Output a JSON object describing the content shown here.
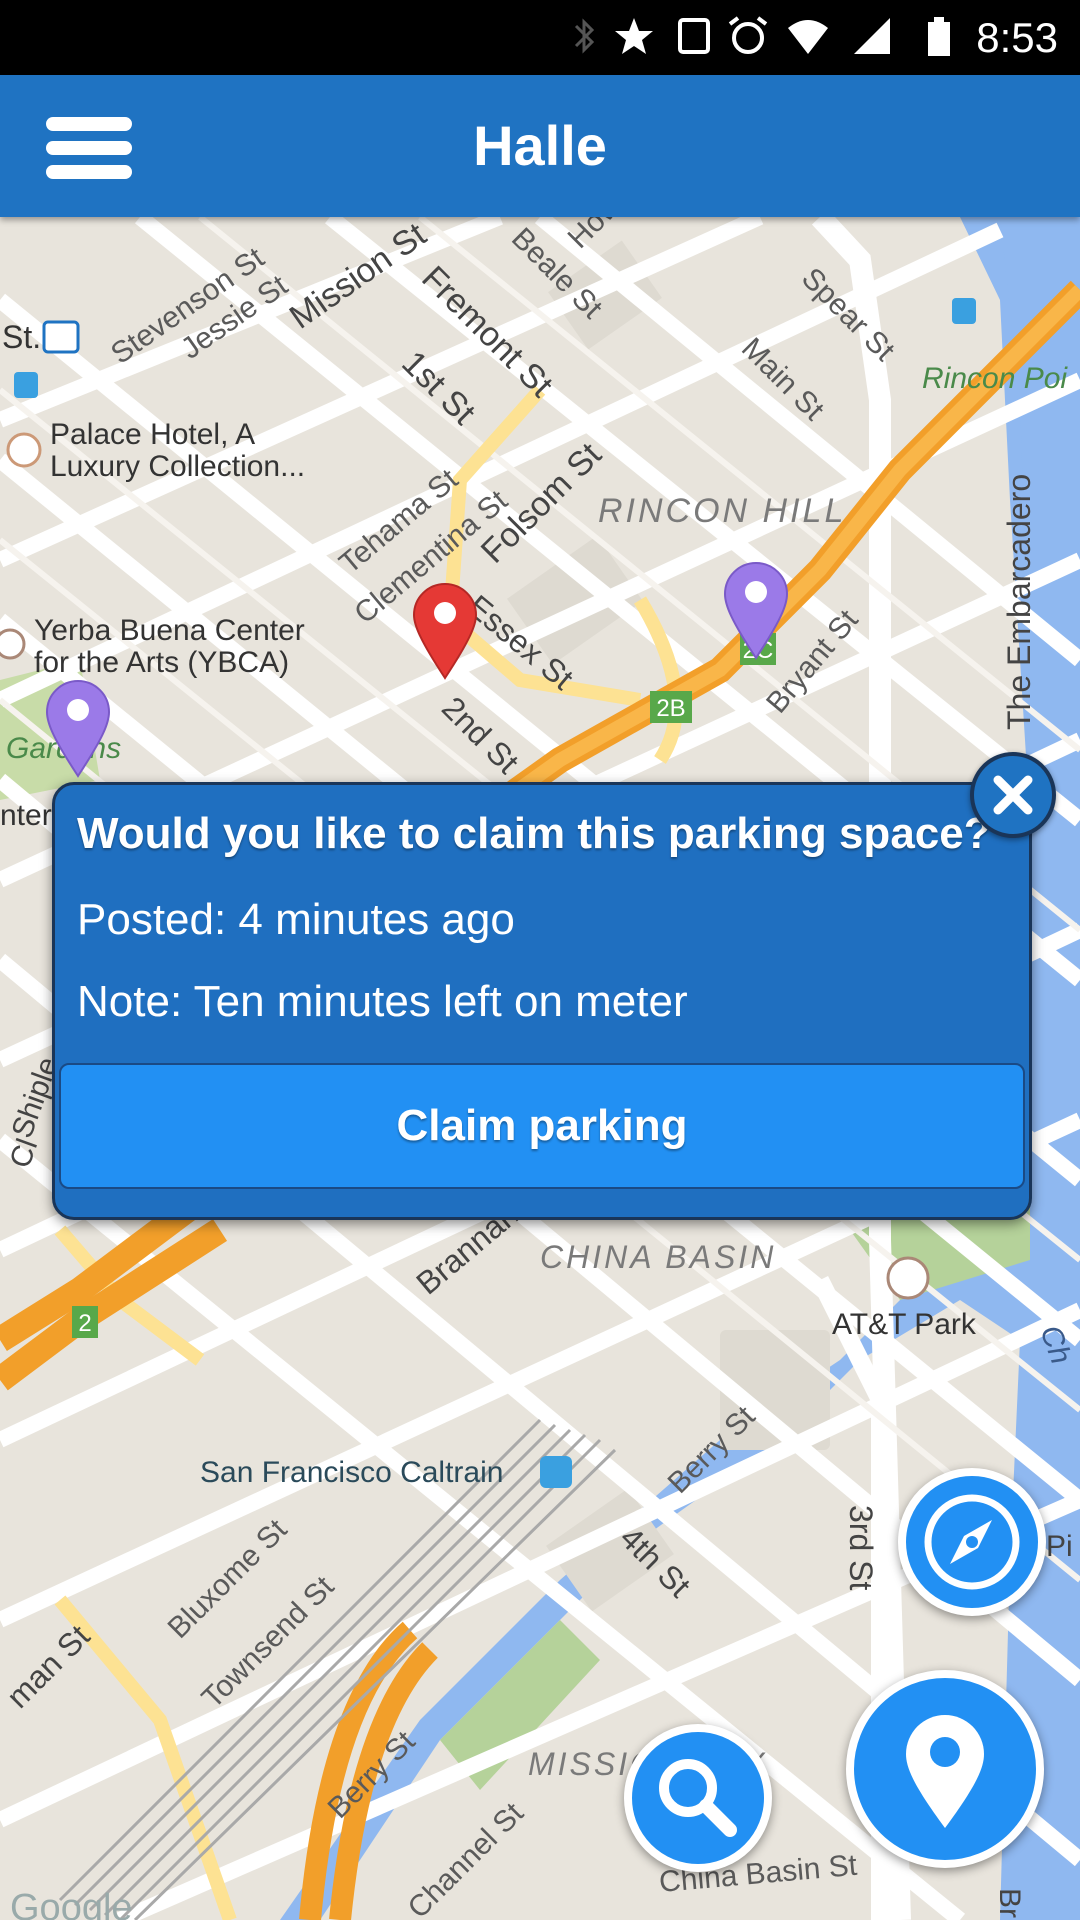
{
  "status_bar": {
    "time": "8:53",
    "icons": [
      "bluetooth-icon",
      "star-icon",
      "vibrate-icon",
      "alarm-icon",
      "wifi-icon",
      "signal-icon",
      "battery-icon"
    ]
  },
  "app_bar": {
    "title": "Halle",
    "menu_icon": "hamburger-menu-icon"
  },
  "map": {
    "labels": {
      "stevenson": "Stevenson St",
      "jessie": "Jessie St",
      "mission": "Mission St",
      "fremont": "Fremont St",
      "beale": "Beale St",
      "howard": "How",
      "spear": "Spear St",
      "main": "Main St",
      "rincon_point": "Rincon Poi",
      "st": "St.",
      "palace1": "Palace Hotel, A",
      "palace2": "Luxury Collection...",
      "first": "1st St",
      "tehama": "Tehama St",
      "clementina": "Clementina St",
      "folsom": "Folsom St",
      "rincon_hill": "RINCON HILL",
      "embarcadero": "The Embarcadero",
      "ybca1": "Yerba Buena Center",
      "ybca2": "for the Arts (YBCA)",
      "essex": "Essex St",
      "bryant": "Bryant St",
      "shield_2c": "2C",
      "shield_2b": "2B",
      "gardens": "Gardens",
      "second": "2nd St",
      "center": "nter",
      "brannan": "Brannan St",
      "china_basin": "CHINA BASIN",
      "att_park": "AT&T Park",
      "shield_2": "2",
      "caltrain": "San Francisco Caltrain",
      "berry1": "Berry St",
      "fourth": "4th St",
      "third": "3rd St",
      "bluxome": "Bluxome St",
      "townsend": "Townsend St",
      "king": "man St",
      "berry2": "Berry St",
      "mission_bay": "MISSION BAY",
      "channel": "Channel St",
      "china_basin_st": "China Basin St",
      "google": "Google",
      "pier": "Pi",
      "ch": "Ch",
      "bri": "Bri",
      "cl": "Cl",
      "shipley": "Shiple"
    },
    "markers": [
      {
        "name": "selected-parking-marker",
        "color": "#e53935"
      },
      {
        "name": "parking-marker",
        "color": "#9b7ae8"
      },
      {
        "name": "parking-marker",
        "color": "#9b7ae8"
      }
    ]
  },
  "popup": {
    "question": "Would you like to claim this parking space?",
    "posted": "Posted: 4 minutes ago",
    "note": "Note: Ten minutes left on meter",
    "claim_label": "Claim parking",
    "close_icon": "close-icon"
  },
  "fabs": {
    "compass_icon": "compass-icon",
    "search_icon": "search-icon",
    "location_icon": "location-pin-icon"
  },
  "colors": {
    "app_bar": "#1f73c2",
    "popup": "#1f6fc0",
    "button": "#2290f3",
    "highway": "#f7a529",
    "water": "#8fb8f0"
  }
}
